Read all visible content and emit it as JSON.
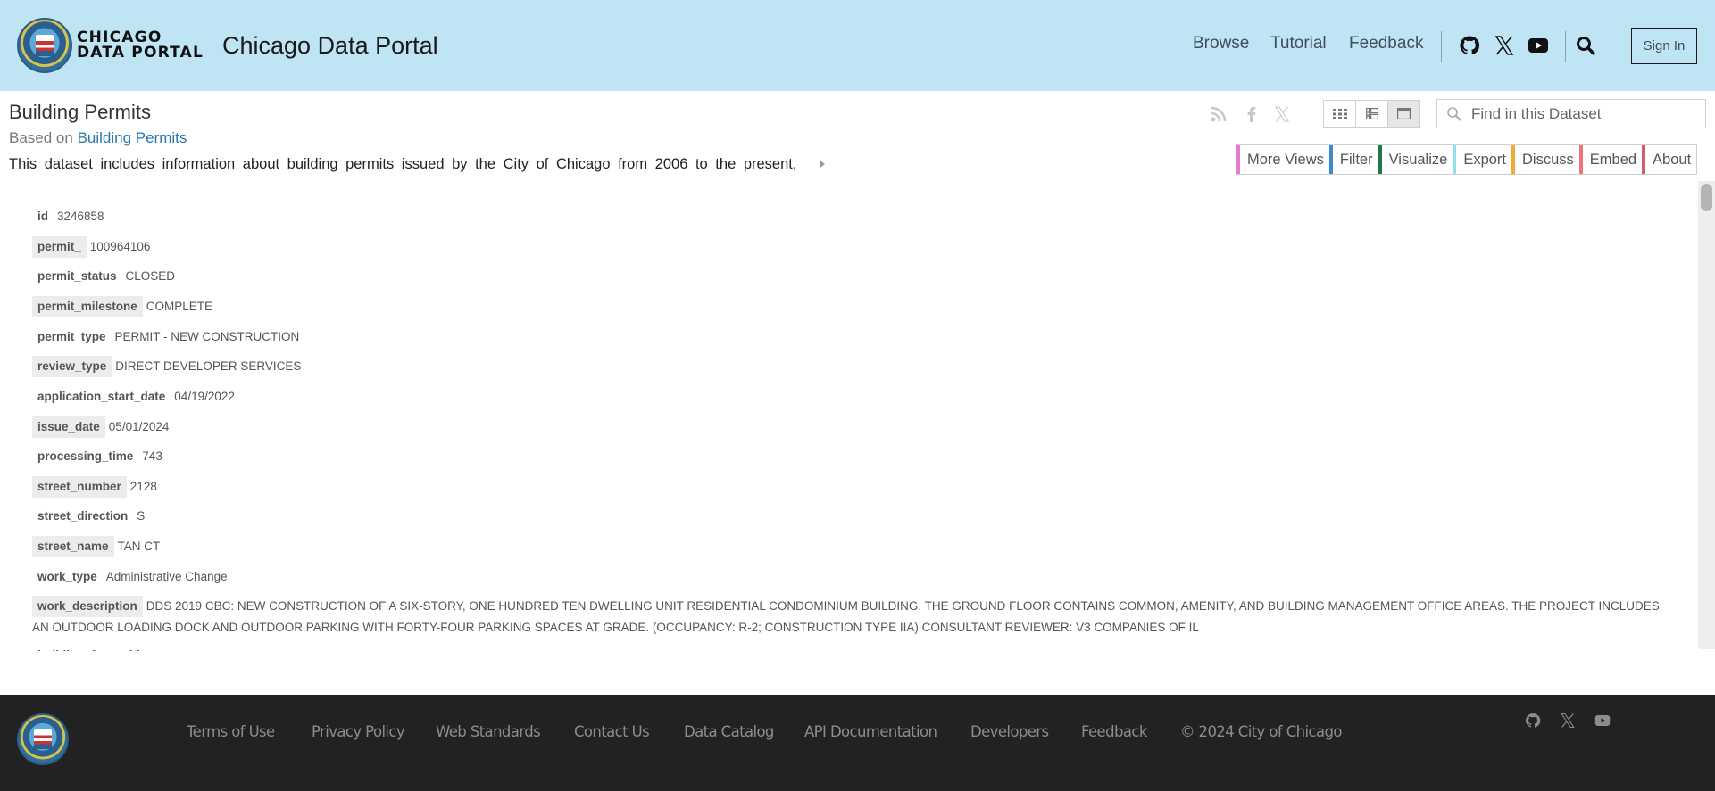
{
  "header": {
    "logo_line1": "CHICAGO",
    "logo_line2": "DATA PORTAL",
    "site_title": "Chicago Data Portal",
    "nav": [
      "Browse",
      "Tutorial",
      "Feedback"
    ],
    "social_icons": [
      "github-icon",
      "x-icon",
      "youtube-icon"
    ],
    "search_icon": "search-icon",
    "sign_in_label": "Sign In"
  },
  "dataset": {
    "title": "Building Permits",
    "based_on_prefix": "Based on",
    "based_on_link": "Building Permits",
    "description": "This dataset includes information about building permits issued by the City of Chicago from 2006 to the present,",
    "share_icons": [
      "rss-icon",
      "facebook-icon",
      "x-icon"
    ],
    "view_modes": [
      "table-view",
      "list-view",
      "row-view"
    ],
    "active_view": "row-view",
    "search_placeholder": "Find in this Dataset",
    "actions": [
      {
        "label": "More Views",
        "color": "#e879d9"
      },
      {
        "label": "Filter",
        "color": "#3a8ccf"
      },
      {
        "label": "Visualize",
        "color": "#1e7a45"
      },
      {
        "label": "Export",
        "color": "#8fe0f5"
      },
      {
        "label": "Discuss",
        "color": "#f5a83a"
      },
      {
        "label": "Embed",
        "color": "#f07478"
      },
      {
        "label": "About",
        "color": "#cf5e6f"
      }
    ]
  },
  "record": [
    {
      "key": "id",
      "value": "3246858"
    },
    {
      "key": "permit_",
      "value": "100964106"
    },
    {
      "key": "permit_status",
      "value": "CLOSED"
    },
    {
      "key": "permit_milestone",
      "value": "COMPLETE"
    },
    {
      "key": "permit_type",
      "value": "PERMIT - NEW CONSTRUCTION"
    },
    {
      "key": "review_type",
      "value": "DIRECT DEVELOPER SERVICES"
    },
    {
      "key": "application_start_date",
      "value": "04/19/2022"
    },
    {
      "key": "issue_date",
      "value": "05/01/2024"
    },
    {
      "key": "processing_time",
      "value": "743"
    },
    {
      "key": "street_number",
      "value": "2128"
    },
    {
      "key": "street_direction",
      "value": "S"
    },
    {
      "key": "street_name",
      "value": "TAN CT"
    },
    {
      "key": "work_type",
      "value": "Administrative Change"
    },
    {
      "key": "work_description",
      "value": "DDS 2019 CBC: NEW CONSTRUCTION OF A SIX-STORY, ONE HUNDRED TEN DWELLING UNIT RESIDENTIAL CONDOMINIUM BUILDING. THE GROUND FLOOR CONTAINS COMMON, AMENITY, AND BUILDING MANAGEMENT OFFICE AREAS. THE PROJECT INCLUDES AN OUTDOOR LOADING DOCK AND OUTDOOR PARKING WITH FORTY-FOUR PARKING SPACES AT GRADE. (OCCUPANCY: R-2; CONSTRUCTION TYPE IIA) CONSULTANT REVIEWER: V3 COMPANIES OF IL"
    },
    {
      "key": "building_fee_paid",
      "value": ""
    }
  ],
  "footer": {
    "links": [
      "Terms of Use",
      "Privacy Policy",
      "Web Standards",
      "Contact Us",
      "Data Catalog",
      "API Documentation",
      "Developers",
      "Feedback"
    ],
    "copyright": "© 2024 City of Chicago",
    "social_icons": [
      "github-icon",
      "x-icon",
      "youtube-icon"
    ]
  },
  "colors": {
    "header_bg": "#bfe4f4",
    "footer_bg": "#222222",
    "link": "#2a77b0"
  }
}
